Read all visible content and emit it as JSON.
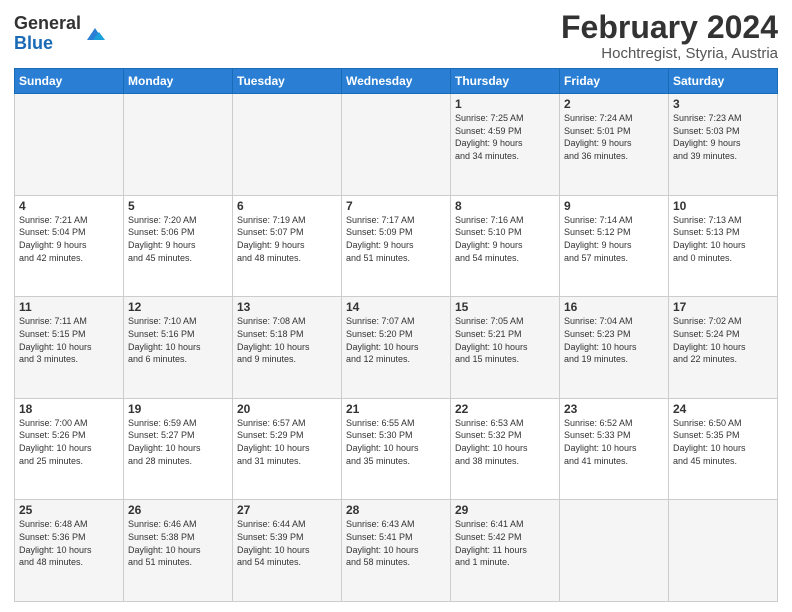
{
  "header": {
    "logo_line1": "General",
    "logo_line2": "Blue",
    "month_year": "February 2024",
    "location": "Hochtregist, Styria, Austria"
  },
  "weekdays": [
    "Sunday",
    "Monday",
    "Tuesday",
    "Wednesday",
    "Thursday",
    "Friday",
    "Saturday"
  ],
  "weeks": [
    [
      {
        "day": "",
        "detail": ""
      },
      {
        "day": "",
        "detail": ""
      },
      {
        "day": "",
        "detail": ""
      },
      {
        "day": "",
        "detail": ""
      },
      {
        "day": "1",
        "detail": "Sunrise: 7:25 AM\nSunset: 4:59 PM\nDaylight: 9 hours\nand 34 minutes."
      },
      {
        "day": "2",
        "detail": "Sunrise: 7:24 AM\nSunset: 5:01 PM\nDaylight: 9 hours\nand 36 minutes."
      },
      {
        "day": "3",
        "detail": "Sunrise: 7:23 AM\nSunset: 5:03 PM\nDaylight: 9 hours\nand 39 minutes."
      }
    ],
    [
      {
        "day": "4",
        "detail": "Sunrise: 7:21 AM\nSunset: 5:04 PM\nDaylight: 9 hours\nand 42 minutes."
      },
      {
        "day": "5",
        "detail": "Sunrise: 7:20 AM\nSunset: 5:06 PM\nDaylight: 9 hours\nand 45 minutes."
      },
      {
        "day": "6",
        "detail": "Sunrise: 7:19 AM\nSunset: 5:07 PM\nDaylight: 9 hours\nand 48 minutes."
      },
      {
        "day": "7",
        "detail": "Sunrise: 7:17 AM\nSunset: 5:09 PM\nDaylight: 9 hours\nand 51 minutes."
      },
      {
        "day": "8",
        "detail": "Sunrise: 7:16 AM\nSunset: 5:10 PM\nDaylight: 9 hours\nand 54 minutes."
      },
      {
        "day": "9",
        "detail": "Sunrise: 7:14 AM\nSunset: 5:12 PM\nDaylight: 9 hours\nand 57 minutes."
      },
      {
        "day": "10",
        "detail": "Sunrise: 7:13 AM\nSunset: 5:13 PM\nDaylight: 10 hours\nand 0 minutes."
      }
    ],
    [
      {
        "day": "11",
        "detail": "Sunrise: 7:11 AM\nSunset: 5:15 PM\nDaylight: 10 hours\nand 3 minutes."
      },
      {
        "day": "12",
        "detail": "Sunrise: 7:10 AM\nSunset: 5:16 PM\nDaylight: 10 hours\nand 6 minutes."
      },
      {
        "day": "13",
        "detail": "Sunrise: 7:08 AM\nSunset: 5:18 PM\nDaylight: 10 hours\nand 9 minutes."
      },
      {
        "day": "14",
        "detail": "Sunrise: 7:07 AM\nSunset: 5:20 PM\nDaylight: 10 hours\nand 12 minutes."
      },
      {
        "day": "15",
        "detail": "Sunrise: 7:05 AM\nSunset: 5:21 PM\nDaylight: 10 hours\nand 15 minutes."
      },
      {
        "day": "16",
        "detail": "Sunrise: 7:04 AM\nSunset: 5:23 PM\nDaylight: 10 hours\nand 19 minutes."
      },
      {
        "day": "17",
        "detail": "Sunrise: 7:02 AM\nSunset: 5:24 PM\nDaylight: 10 hours\nand 22 minutes."
      }
    ],
    [
      {
        "day": "18",
        "detail": "Sunrise: 7:00 AM\nSunset: 5:26 PM\nDaylight: 10 hours\nand 25 minutes."
      },
      {
        "day": "19",
        "detail": "Sunrise: 6:59 AM\nSunset: 5:27 PM\nDaylight: 10 hours\nand 28 minutes."
      },
      {
        "day": "20",
        "detail": "Sunrise: 6:57 AM\nSunset: 5:29 PM\nDaylight: 10 hours\nand 31 minutes."
      },
      {
        "day": "21",
        "detail": "Sunrise: 6:55 AM\nSunset: 5:30 PM\nDaylight: 10 hours\nand 35 minutes."
      },
      {
        "day": "22",
        "detail": "Sunrise: 6:53 AM\nSunset: 5:32 PM\nDaylight: 10 hours\nand 38 minutes."
      },
      {
        "day": "23",
        "detail": "Sunrise: 6:52 AM\nSunset: 5:33 PM\nDaylight: 10 hours\nand 41 minutes."
      },
      {
        "day": "24",
        "detail": "Sunrise: 6:50 AM\nSunset: 5:35 PM\nDaylight: 10 hours\nand 45 minutes."
      }
    ],
    [
      {
        "day": "25",
        "detail": "Sunrise: 6:48 AM\nSunset: 5:36 PM\nDaylight: 10 hours\nand 48 minutes."
      },
      {
        "day": "26",
        "detail": "Sunrise: 6:46 AM\nSunset: 5:38 PM\nDaylight: 10 hours\nand 51 minutes."
      },
      {
        "day": "27",
        "detail": "Sunrise: 6:44 AM\nSunset: 5:39 PM\nDaylight: 10 hours\nand 54 minutes."
      },
      {
        "day": "28",
        "detail": "Sunrise: 6:43 AM\nSunset: 5:41 PM\nDaylight: 10 hours\nand 58 minutes."
      },
      {
        "day": "29",
        "detail": "Sunrise: 6:41 AM\nSunset: 5:42 PM\nDaylight: 11 hours\nand 1 minute."
      },
      {
        "day": "",
        "detail": ""
      },
      {
        "day": "",
        "detail": ""
      }
    ]
  ]
}
